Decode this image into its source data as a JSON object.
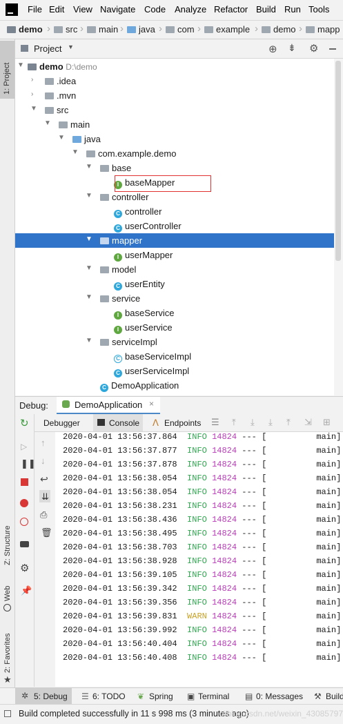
{
  "menu": [
    "File",
    "Edit",
    "View",
    "Navigate",
    "Code",
    "Analyze",
    "Refactor",
    "Build",
    "Run",
    "Tools"
  ],
  "breadcrumb": [
    "demo",
    "src",
    "main",
    "java",
    "com",
    "example",
    "demo",
    "mapp"
  ],
  "left_stripe": {
    "project_tab": "1: Project",
    "structure_tab": "Z: Structure",
    "web_tab": "Web",
    "favorites_tab": "2: Favorites"
  },
  "project_panel": {
    "title": "Project"
  },
  "tree": [
    {
      "label": "demo",
      "hint": "D:\\demo"
    },
    {
      "label": ".idea"
    },
    {
      "label": ".mvn"
    },
    {
      "label": "src"
    },
    {
      "label": "main"
    },
    {
      "label": "java"
    },
    {
      "label": "com.example.demo"
    },
    {
      "label": "base"
    },
    {
      "label": "baseMapper"
    },
    {
      "label": "controller"
    },
    {
      "label": "controller"
    },
    {
      "label": "userController"
    },
    {
      "label": "mapper"
    },
    {
      "label": "userMapper"
    },
    {
      "label": "model"
    },
    {
      "label": "userEntity"
    },
    {
      "label": "service"
    },
    {
      "label": "baseService"
    },
    {
      "label": "userService"
    },
    {
      "label": "serviceImpl"
    },
    {
      "label": "baseServiceImpl"
    },
    {
      "label": "userServiceImpl"
    },
    {
      "label": "DemoApplication"
    }
  ],
  "debug": {
    "label": "Debug:",
    "session_tab": "DemoApplication"
  },
  "debug_toolbar": {
    "debugger": "Debugger",
    "console": "Console",
    "endpoints": "Endpoints"
  },
  "log": [
    {
      "ts": "2020-04-01 13:56:37.864",
      "level": "INFO",
      "pid": "14824",
      "rest": " --- [",
      "thread": "main]"
    },
    {
      "ts": "2020-04-01 13:56:37.877",
      "level": "INFO",
      "pid": "14824",
      "rest": " --- [",
      "thread": "main]"
    },
    {
      "ts": "2020-04-01 13:56:37.878",
      "level": "INFO",
      "pid": "14824",
      "rest": " --- [",
      "thread": "main]"
    },
    {
      "ts": "2020-04-01 13:56:38.054",
      "level": "INFO",
      "pid": "14824",
      "rest": " --- [",
      "thread": "main]"
    },
    {
      "ts": "2020-04-01 13:56:38.054",
      "level": "INFO",
      "pid": "14824",
      "rest": " --- [",
      "thread": "main]"
    },
    {
      "ts": "2020-04-01 13:56:38.231",
      "level": "INFO",
      "pid": "14824",
      "rest": " --- [",
      "thread": "main]"
    },
    {
      "ts": "2020-04-01 13:56:38.436",
      "level": "INFO",
      "pid": "14824",
      "rest": " --- [",
      "thread": "main]"
    },
    {
      "ts": "2020-04-01 13:56:38.495",
      "level": "INFO",
      "pid": "14824",
      "rest": " --- [",
      "thread": "main]"
    },
    {
      "ts": "2020-04-01 13:56:38.703",
      "level": "INFO",
      "pid": "14824",
      "rest": " --- [",
      "thread": "main]"
    },
    {
      "ts": "2020-04-01 13:56:38.928",
      "level": "INFO",
      "pid": "14824",
      "rest": " --- [",
      "thread": "main]"
    },
    {
      "ts": "2020-04-01 13:56:39.105",
      "level": "INFO",
      "pid": "14824",
      "rest": " --- [",
      "thread": "main]"
    },
    {
      "ts": "2020-04-01 13:56:39.342",
      "level": "INFO",
      "pid": "14824",
      "rest": " --- [",
      "thread": "main]"
    },
    {
      "ts": "2020-04-01 13:56:39.356",
      "level": "INFO",
      "pid": "14824",
      "rest": " --- [",
      "thread": "main]"
    },
    {
      "ts": "2020-04-01 13:56:39.831",
      "level": "WARN",
      "pid": "14824",
      "rest": " --- [",
      "thread": "main]"
    },
    {
      "ts": "2020-04-01 13:56:39.992",
      "level": "INFO",
      "pid": "14824",
      "rest": " --- [",
      "thread": "main]"
    },
    {
      "ts": "2020-04-01 13:56:40.404",
      "level": "INFO",
      "pid": "14824",
      "rest": " --- [",
      "thread": "main]"
    },
    {
      "ts": "2020-04-01 13:56:40.408",
      "level": "INFO",
      "pid": "14824",
      "rest": " --- [",
      "thread": "main]"
    }
  ],
  "bottom_tabs": [
    "5: Debug",
    "6: TODO",
    "Spring",
    "Terminal",
    "0: Messages",
    "Build"
  ],
  "status": {
    "message": "Build completed successfully in 11 s 998 ms (3 minutes ago)",
    "watermark": "https://blog.csdn.net/weixin_43085797"
  },
  "colors": {
    "selection": "#2f74c9",
    "info": "#2fa84f",
    "warn": "#c9a227",
    "pid": "#b83cb8",
    "highlight_box": "#e03030"
  }
}
